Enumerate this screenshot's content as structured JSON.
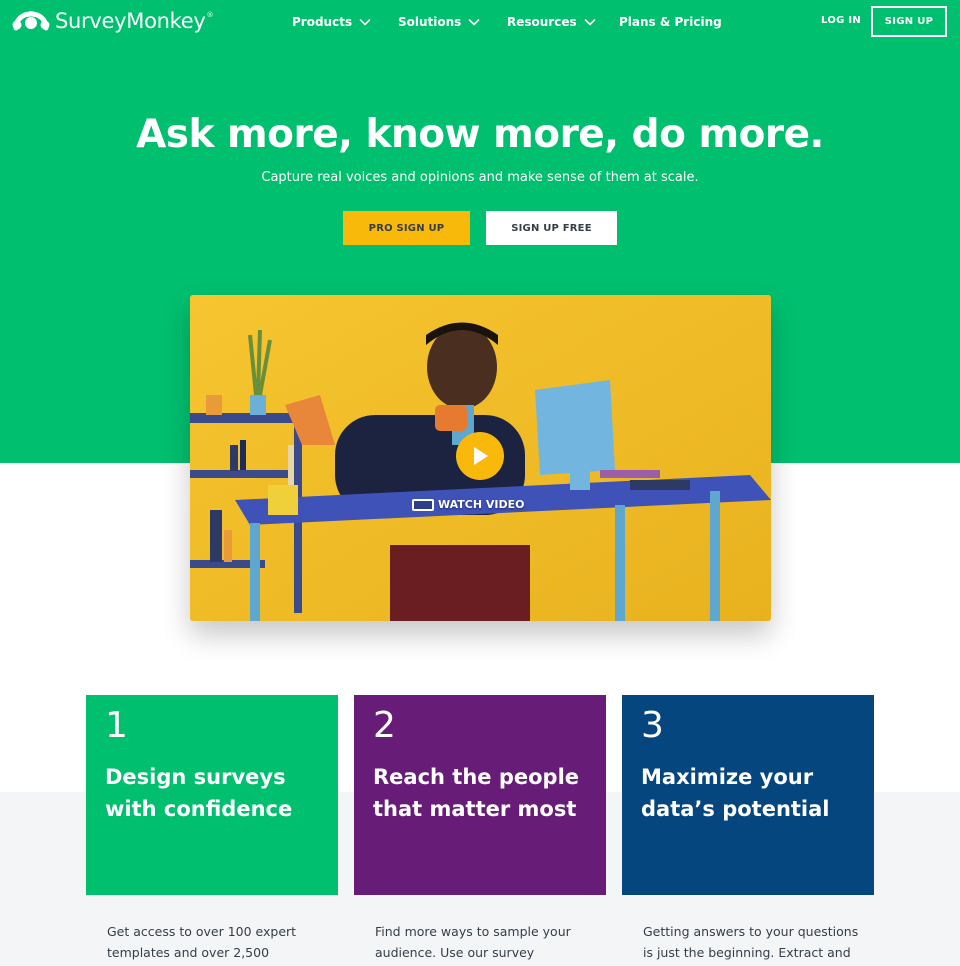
{
  "header": {
    "logo_text": "SurveyMonkey",
    "logo_reg": "®",
    "nav": [
      {
        "label": "Products",
        "icon": "chevron-down-icon"
      },
      {
        "label": "Solutions",
        "icon": "chevron-down-icon"
      },
      {
        "label": "Resources",
        "icon": "chevron-down-icon"
      },
      {
        "label": "Plans & Pricing"
      }
    ],
    "login_label": "LOG IN",
    "signup_label": "SIGN UP"
  },
  "hero": {
    "title": "Ask more, know more, do more.",
    "subtitle": "Capture real voices and opinions and make sense of them at scale.",
    "pro_button": "PRO SIGN UP",
    "free_button": "SIGN UP FREE"
  },
  "video": {
    "watch_label": "WATCH VIDEO",
    "play_icon": "play-icon"
  },
  "cards": [
    {
      "number": "1",
      "title": "Design surveys with confidence",
      "description": "Get access to over 100 expert templates and over 2,500"
    },
    {
      "number": "2",
      "title": "Reach the people that matter most",
      "description": "Find more ways to sample your audience. Use our survey"
    },
    {
      "number": "3",
      "title": "Maximize your data’s potential",
      "description": "Getting answers to your questions is just the beginning. Extract and"
    }
  ],
  "colors": {
    "brand_green": "#00bf6f",
    "purple": "#671d78",
    "navy": "#05467e",
    "yellow": "#f8b90b",
    "text_dark": "#333e48"
  }
}
